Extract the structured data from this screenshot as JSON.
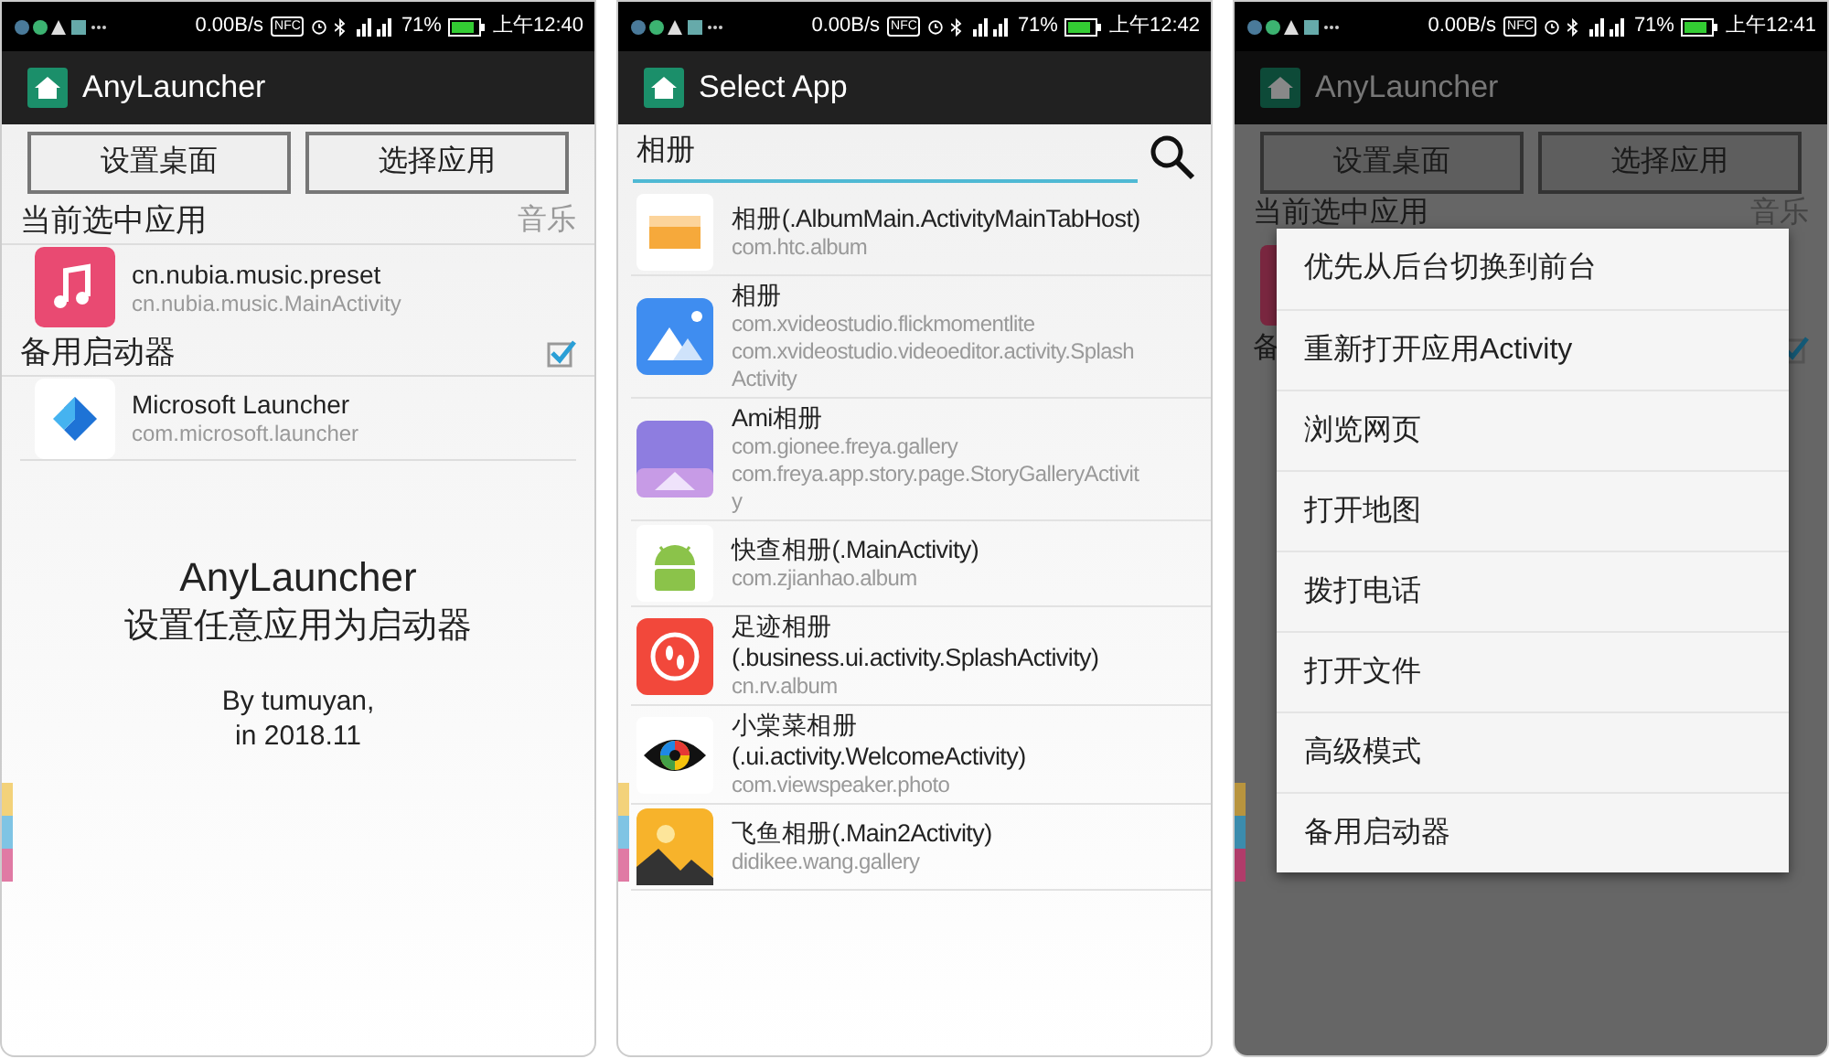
{
  "screens": [
    {
      "kind": "home",
      "status_bar": {
        "speed": "0.00B/s",
        "nfc": "NFC",
        "battery": "71%",
        "time": "上午12:40"
      },
      "title": "AnyLauncher",
      "buttons": [
        "设置桌面",
        "选择应用"
      ],
      "current": {
        "label": "当前选中应用",
        "hint": "音乐",
        "app": {
          "name": "cn.nubia.music.preset",
          "detail": "cn.nubia.music.MainActivity"
        }
      },
      "backup": {
        "label": "备用启动器",
        "checked": true,
        "app": {
          "name": "Microsoft Launcher",
          "detail": "com.microsoft.launcher"
        }
      },
      "about": {
        "name": "AnyLauncher",
        "tagline": "设置任意应用为启动器",
        "author": "By tumuyan,",
        "date": "in 2018.11"
      }
    },
    {
      "kind": "select",
      "status_bar": {
        "speed": "0.00B/s",
        "nfc": "NFC",
        "battery": "71%",
        "time": "上午12:42"
      },
      "title": "Select App",
      "search": {
        "value": "相册"
      },
      "apps": [
        {
          "title_lines": [
            "相册(.AlbumMain.ActivityMainTabHost)"
          ],
          "detail_lines": [
            "com.htc.album"
          ]
        },
        {
          "title_lines": [
            "相册"
          ],
          "detail_lines": [
            "com.xvideostudio.flickmomentlite",
            "com.xvideostudio.videoeditor.activity.Splash",
            "Activity"
          ]
        },
        {
          "title_lines": [
            "Ami相册"
          ],
          "detail_lines": [
            "com.gionee.freya.gallery",
            "com.freya.app.story.page.StoryGalleryActivit",
            "y"
          ]
        },
        {
          "title_lines": [
            "快查相册(.MainActivity)"
          ],
          "detail_lines": [
            "com.zjianhao.album"
          ]
        },
        {
          "title_lines": [
            "足迹相册",
            "(.business.ui.activity.SplashActivity)"
          ],
          "detail_lines": [
            "cn.rv.album"
          ]
        },
        {
          "title_lines": [
            "小棠菜相册",
            "(.ui.activity.WelcomeActivity)"
          ],
          "detail_lines": [
            "com.viewspeaker.photo"
          ]
        },
        {
          "title_lines": [
            "飞鱼相册(.Main2Activity)"
          ],
          "detail_lines": [
            "didikee.wang.gallery"
          ]
        }
      ]
    },
    {
      "kind": "menu",
      "status_bar": {
        "speed": "0.00B/s",
        "nfc": "NFC",
        "battery": "71%",
        "time": "上午12:41"
      },
      "title": "AnyLauncher",
      "buttons": [
        "设置桌面",
        "选择应用"
      ],
      "current": {
        "label": "当前选中应用",
        "hint": "音乐"
      },
      "backup": {
        "label": "备",
        "checked": true
      },
      "menu": [
        "优先从后台切换到前台",
        "重新打开应用Activity",
        "浏览网页",
        "打开地图",
        "拨打电话",
        "打开文件",
        "高级模式",
        "备用启动器"
      ]
    }
  ]
}
